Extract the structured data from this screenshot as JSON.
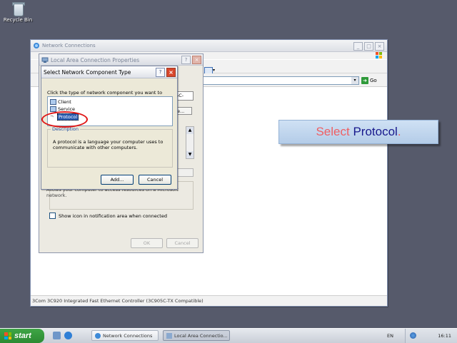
{
  "desktop": {
    "recycle_bin_label": "Recycle Bin"
  },
  "main_window": {
    "title": "Network Connections",
    "go_label": "Go",
    "status_text": "3Com 3C920 Integrated Fast Ethernet Controller (3C905C-TX Compatible)",
    "icon": "network-connections-icon"
  },
  "properties_dialog": {
    "title": "Local Area Connection Properties",
    "component_field_fragment": "05C-",
    "description_fragment": "Allows your computer to access resources on a Microsoft network.",
    "show_icon_label": "Show icon in notification area when connected",
    "ok_label": "OK",
    "cancel_label": "Cancel"
  },
  "select_dialog": {
    "title": "Select Network Component Type",
    "instruction": "Click the type of network component you want to install:",
    "items": [
      {
        "label": "Client",
        "icon": "client-icon"
      },
      {
        "label": "Service",
        "icon": "service-icon"
      },
      {
        "label": "Protocol",
        "icon": "protocol-icon",
        "selected": true
      }
    ],
    "description_label": "Description",
    "description_text": "A protocol is a language your computer uses to communicate with other computers.",
    "add_label": "Add...",
    "cancel_label": "Cancel"
  },
  "callout": {
    "word1": "Select",
    "word2": "Protocol",
    "punct": "."
  },
  "taskbar": {
    "start_label": "start",
    "tasks": [
      {
        "label": "Network Connections",
        "active": false
      },
      {
        "label": "Local Area Connectio...",
        "active": true
      }
    ],
    "language": "EN",
    "clock": "16:11"
  },
  "colors": {
    "desktop_bg": "#565a6b",
    "highlight_circle": "#e01515",
    "callout_red": "#ef5f63",
    "callout_blue": "#17188c",
    "start_green": "#3ea545"
  }
}
